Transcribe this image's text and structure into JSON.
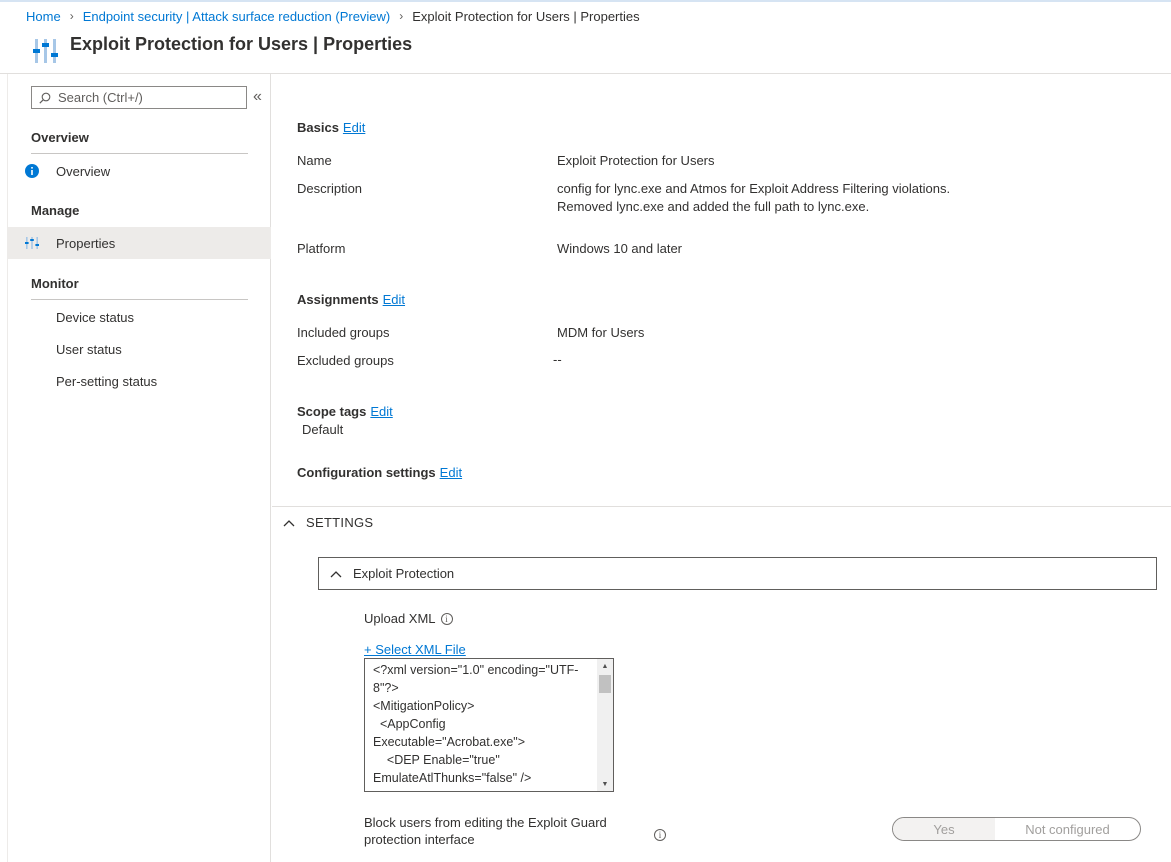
{
  "breadcrumb": {
    "home": "Home",
    "parent": "Endpoint security | Attack surface reduction (Preview)",
    "current": "Exploit Protection for Users | Properties"
  },
  "page": {
    "title": "Exploit Protection for Users | Properties",
    "icon": "properties-sliders-icon"
  },
  "sidebar": {
    "search_placeholder": "Search (Ctrl+/)",
    "collapse_glyph": "«",
    "sections": {
      "overview": "Overview",
      "manage": "Manage",
      "monitor": "Monitor"
    },
    "items": {
      "overview": "Overview",
      "properties": "Properties",
      "device_status": "Device status",
      "user_status": "User status",
      "per_setting_status": "Per-setting status"
    }
  },
  "basics": {
    "heading": "Basics",
    "edit": "Edit",
    "name_label": "Name",
    "name_value": "Exploit Protection for Users",
    "description_label": "Description",
    "description_line1": "config for lync.exe and Atmos for Exploit Address Filtering violations.",
    "description_line2": "Removed lync.exe and added the full path to lync.exe.",
    "platform_label": "Platform",
    "platform_value": "Windows 10 and later"
  },
  "assignments": {
    "heading": "Assignments",
    "edit": "Edit",
    "included_label": "Included groups",
    "included_value": "MDM for Users",
    "excluded_label": "Excluded groups",
    "excluded_value": "--"
  },
  "scope_tags": {
    "heading": "Scope tags",
    "edit": "Edit",
    "value": "Default"
  },
  "configuration": {
    "heading": "Configuration settings",
    "edit": "Edit"
  },
  "settings": {
    "toggle_label": "SETTINGS",
    "group_label": "Exploit Protection",
    "upload_label": "Upload XML",
    "select_file": "+ Select XML File",
    "xml_content": "<?xml version=\"1.0\" encoding=\"UTF-\n8\"?>\n<MitigationPolicy>\n  <AppConfig\nExecutable=\"Acrobat.exe\">\n    <DEP Enable=\"true\"\nEmulateAtlThunks=\"false\" />",
    "block_label": "Block users from editing the Exploit Guard protection interface",
    "toggle_yes": "Yes",
    "toggle_no": "Not configured"
  },
  "colors": {
    "accent": "#0078d4",
    "active_nav": "#edebe9",
    "info_blue": "#0078d4"
  }
}
